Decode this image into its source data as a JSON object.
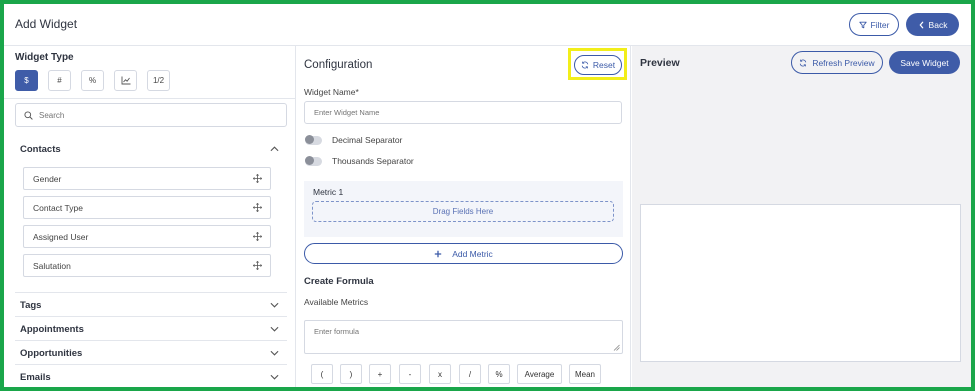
{
  "header": {
    "title": "Add Widget",
    "filter_label": "Filter",
    "back_label": "Back"
  },
  "left": {
    "widget_type_title": "Widget Type",
    "types": [
      {
        "label": "$",
        "active": true
      },
      {
        "label": "#",
        "active": false
      },
      {
        "label": "%",
        "active": false
      },
      {
        "label": "",
        "icon": "line-chart-icon",
        "active": false
      },
      {
        "label": "1/2",
        "active": false
      }
    ],
    "search_placeholder": "Search",
    "sections": [
      {
        "label": "Contacts",
        "expanded": true,
        "fields": [
          "Gender",
          "Contact Type",
          "Assigned User",
          "Salutation"
        ]
      },
      {
        "label": "Tags",
        "expanded": false
      },
      {
        "label": "Appointments",
        "expanded": false
      },
      {
        "label": "Opportunities",
        "expanded": false
      },
      {
        "label": "Emails",
        "expanded": false
      }
    ]
  },
  "config": {
    "title": "Configuration",
    "reset_label": "Reset",
    "widget_name_label": "Widget Name*",
    "widget_name_placeholder": "Enter Widget Name",
    "decimal_separator_label": "Decimal Separator",
    "thousands_separator_label": "Thousands Separator",
    "metric_label": "Metric 1",
    "drag_fields_label": "Drag Fields Here",
    "add_metric_label": "Add Metric",
    "create_formula_title": "Create Formula",
    "available_metrics_label": "Available Metrics",
    "formula_placeholder": "Enter formula",
    "operators": [
      "(",
      ")",
      "+",
      "-",
      "x",
      "/",
      "%",
      "Average",
      "Mean"
    ]
  },
  "preview": {
    "title": "Preview",
    "refresh_label": "Refresh Preview",
    "save_label": "Save Widget"
  },
  "colors": {
    "primary": "#3f5ca8",
    "frame_border": "#1aa64a",
    "highlight": "#f2ee1a"
  }
}
